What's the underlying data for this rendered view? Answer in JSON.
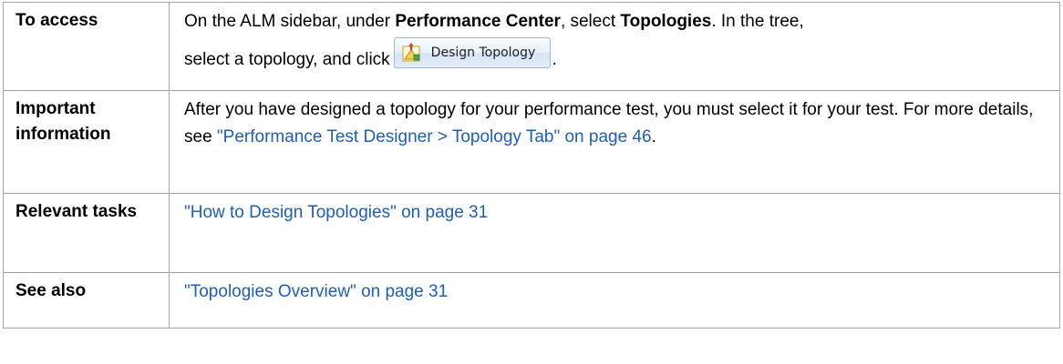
{
  "table": {
    "rows": [
      {
        "label": "To access",
        "access": {
          "part1": "On the ALM sidebar, under ",
          "bold1": "Performance Center",
          "part2": ", select ",
          "bold2": "Topologies",
          "part3": ". In the tree,",
          "part4": "select a topology, and click",
          "button_label": "Design Topology",
          "button_icon": "design-topology-icon",
          "part5": "."
        }
      },
      {
        "label": "Important information",
        "text": "After you have designed a topology for your performance test, you must select it for your test. For more details, see ",
        "link": "\"Performance Test Designer > Topology Tab\" on page 46",
        "text_end": "."
      },
      {
        "label": "Relevant tasks",
        "link": "\"How to Design Topologies\" on page 31"
      },
      {
        "label": "See also",
        "link": "\"Topologies Overview\" on page 31"
      }
    ]
  },
  "colors": {
    "link": "#1a5ec3",
    "border": "#a6a6a6"
  }
}
